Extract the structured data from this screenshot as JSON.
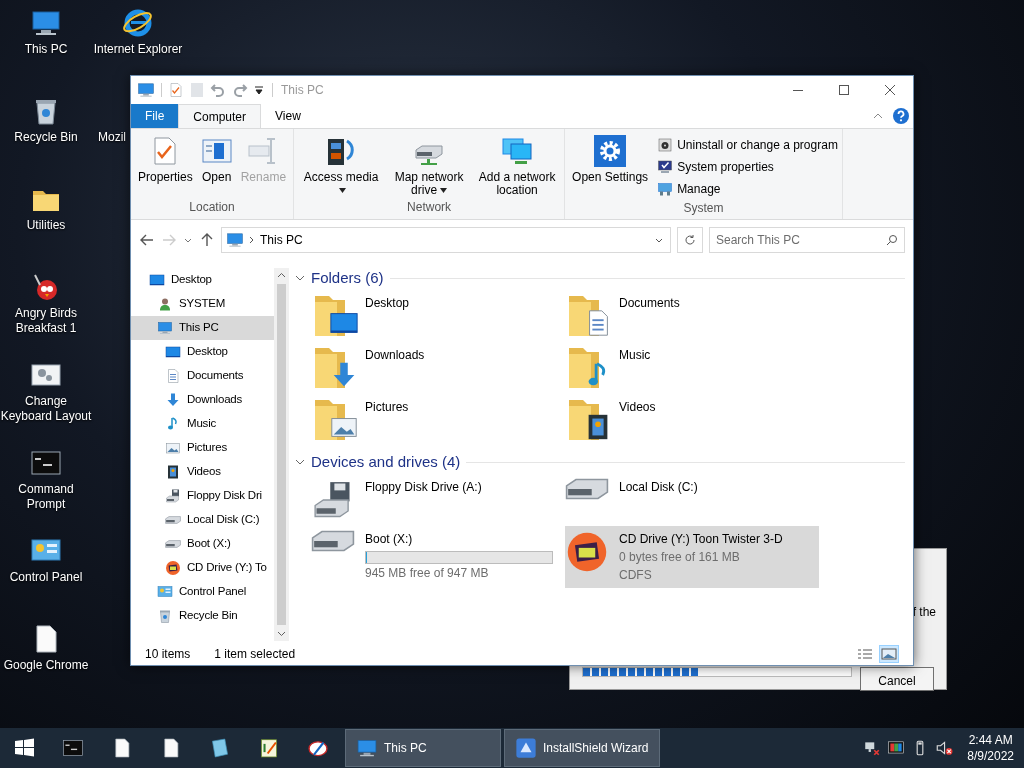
{
  "desktop_icons": [
    {
      "label": "This PC",
      "kind": "pc"
    },
    {
      "label": "Internet Explorer",
      "kind": "ie"
    },
    {
      "label": "Recycle Bin",
      "kind": "recycle"
    },
    {
      "label": "Mozil",
      "kind": "none"
    },
    {
      "label": "Utilities",
      "kind": "folder"
    },
    {
      "label": "Angry Birds Breakfast 1",
      "kind": "game"
    },
    {
      "label": "Change Keyboard Layout",
      "kind": "keyboard"
    },
    {
      "label": "Command Prompt",
      "kind": "cmd"
    },
    {
      "label": "Control Panel",
      "kind": "control"
    },
    {
      "label": "Google Chrome",
      "kind": "file"
    }
  ],
  "installer_dialog": {
    "text": "f the",
    "progress": {
      "level": 0.43
    },
    "button": "Cancel"
  },
  "explorer": {
    "title": "This PC",
    "ribbon_tabs": [
      {
        "label": "File",
        "kind": "file",
        "selected": false
      },
      {
        "label": "Computer",
        "kind": "tab",
        "selected": true
      },
      {
        "label": "View",
        "kind": "tab",
        "selected": false
      }
    ],
    "ribbon_groups": [
      {
        "label": "Location",
        "buttons": [
          {
            "label": "Properties",
            "kind": "properties",
            "disabled": false,
            "dropdown": false
          },
          {
            "label": "Open",
            "kind": "open",
            "disabled": false,
            "dropdown": false
          },
          {
            "label": "Rename",
            "kind": "rename",
            "disabled": true,
            "dropdown": false
          }
        ]
      },
      {
        "label": "Network",
        "buttons": [
          {
            "label": "Access media",
            "kind": "media",
            "disabled": false,
            "dropdown": true
          },
          {
            "label": "Map network drive",
            "kind": "mapdrive",
            "disabled": false,
            "dropdown": true
          },
          {
            "label": "Add a network location",
            "kind": "netloc",
            "disabled": false,
            "dropdown": false
          }
        ]
      },
      {
        "label": "System",
        "buttons": [
          {
            "label": "Open Settings",
            "kind": "settings",
            "disabled": false,
            "dropdown": false
          }
        ],
        "small_buttons": [
          {
            "label": "Uninstall or change a program",
            "kind": "uninstall"
          },
          {
            "label": "System properties",
            "kind": "sysprops"
          },
          {
            "label": "Manage",
            "kind": "manage"
          }
        ]
      }
    ],
    "address": "This PC",
    "search": {
      "placeholder": "Search This PC"
    },
    "nav_tree": [
      {
        "label": "Desktop",
        "kind": "desktop",
        "selected": false,
        "children": [
          {
            "label": "SYSTEM",
            "kind": "user",
            "selected": false
          },
          {
            "label": "This PC",
            "kind": "pc",
            "selected": true,
            "children": [
              {
                "label": "Desktop",
                "kind": "desktop",
                "selected": false
              },
              {
                "label": "Documents",
                "kind": "documents",
                "selected": false
              },
              {
                "label": "Downloads",
                "kind": "downloads",
                "selected": false
              },
              {
                "label": "Music",
                "kind": "music",
                "selected": false
              },
              {
                "label": "Pictures",
                "kind": "pictures",
                "selected": false
              },
              {
                "label": "Videos",
                "kind": "videos",
                "selected": false
              },
              {
                "label": "Floppy Disk Dri",
                "kind": "floppy",
                "selected": false
              },
              {
                "label": "Local Disk (C:)",
                "kind": "disk",
                "selected": false
              },
              {
                "label": "Boot (X:)",
                "kind": "disk",
                "selected": false
              },
              {
                "label": "CD Drive (Y:) To",
                "kind": "cd",
                "selected": false
              }
            ]
          },
          {
            "label": "Control Panel",
            "kind": "control",
            "selected": false
          },
          {
            "label": "Recycle Bin",
            "kind": "recycle",
            "selected": false
          }
        ]
      }
    ],
    "sections": [
      {
        "title": "Folders (6)",
        "expanded": true,
        "items": [
          {
            "name": "Desktop",
            "kind": "desktop",
            "selected": false
          },
          {
            "name": "Documents",
            "kind": "documents",
            "selected": false
          },
          {
            "name": "Downloads",
            "kind": "downloads",
            "selected": false
          },
          {
            "name": "Music",
            "kind": "music",
            "selected": false
          },
          {
            "name": "Pictures",
            "kind": "pictures",
            "selected": false
          },
          {
            "name": "Videos",
            "kind": "videos",
            "selected": false
          }
        ]
      },
      {
        "title": "Devices and drives (4)",
        "expanded": true,
        "items": [
          {
            "name": "Floppy Disk Drive (A:)",
            "kind": "floppy",
            "selected": false
          },
          {
            "name": "Local Disk (C:)",
            "kind": "disk",
            "selected": false
          },
          {
            "name": "Boot (X:)",
            "kind": "disk",
            "selected": false,
            "level": 0.002,
            "details": [
              "945 MB free of 947 MB"
            ]
          },
          {
            "name": "CD Drive (Y:) Toon Twister 3-D",
            "kind": "cd",
            "selected": true,
            "details": [
              "0 bytes free of 161 MB",
              "CDFS"
            ]
          }
        ]
      }
    ],
    "status_bar": {
      "items": "10 items",
      "selection": "1 item selected"
    },
    "views": [
      {
        "kind": "details",
        "selected": false
      },
      {
        "kind": "large",
        "selected": true
      }
    ]
  },
  "taskbar": {
    "tasks": [
      {
        "label": "This PC",
        "kind": "pc"
      },
      {
        "label": "InstallShield Wizard",
        "kind": "installer"
      }
    ],
    "time": "2:44 AM",
    "date": "8/9/2022"
  }
}
